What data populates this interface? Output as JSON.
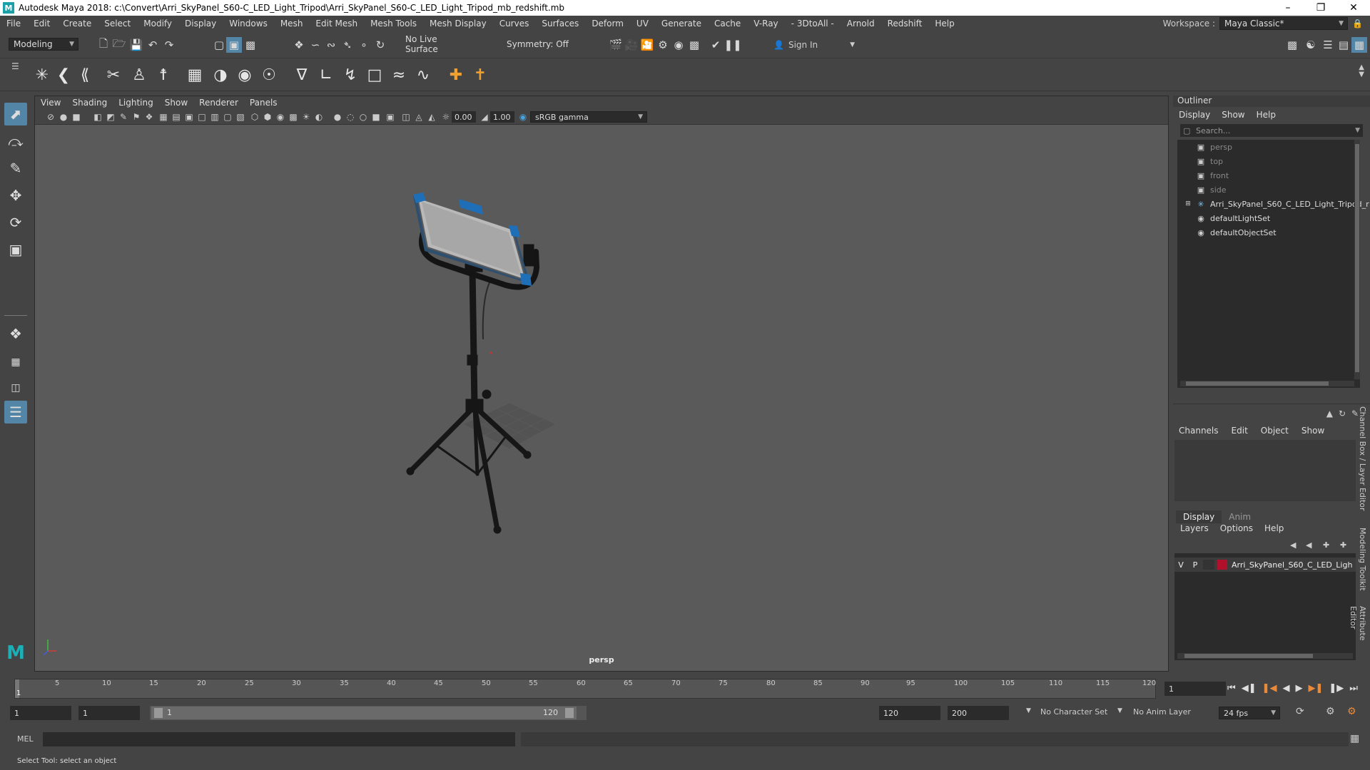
{
  "title": "Autodesk Maya 2018: c:\\Convert\\Arri_SkyPanel_S60-C_LED_Light_Tripod\\Arri_SkyPanel_S60-C_LED_Light_Tripod_mb_redshift.mb",
  "menubar": [
    "File",
    "Edit",
    "Create",
    "Select",
    "Modify",
    "Display",
    "Windows",
    "Mesh",
    "Edit Mesh",
    "Mesh Tools",
    "Mesh Display",
    "Curves",
    "Surfaces",
    "Deform",
    "UV",
    "Generate",
    "Cache",
    "V-Ray",
    "- 3DtoAll -",
    "Arnold",
    "Redshift",
    "Help"
  ],
  "workspace": {
    "label": "Workspace :",
    "value": "Maya Classic*"
  },
  "status": {
    "mode": "Modeling",
    "live_surface": "No Live Surface",
    "symmetry": "Symmetry: Off",
    "sign_in": "Sign In"
  },
  "viewport": {
    "menu": [
      "View",
      "Shading",
      "Lighting",
      "Show",
      "Renderer",
      "Panels"
    ],
    "exposure": "0.00",
    "gamma": "1.00",
    "colorspace": "sRGB gamma",
    "camera_label": "persp"
  },
  "outliner": {
    "title": "Outliner",
    "menu": [
      "Display",
      "Show",
      "Help"
    ],
    "search_placeholder": "Search...",
    "items": [
      "persp",
      "top",
      "front",
      "side",
      "Arri_SkyPanel_S60_C_LED_Light_Tripod_r",
      "defaultLightSet",
      "defaultObjectSet"
    ]
  },
  "channelbox": {
    "menu": [
      "Channels",
      "Edit",
      "Object",
      "Show"
    ]
  },
  "layereditor": {
    "tabs": [
      "Display",
      "Anim"
    ],
    "menu": [
      "Layers",
      "Options",
      "Help"
    ],
    "layer": {
      "v": "V",
      "p": "P",
      "name": "Arri_SkyPanel_S60_C_LED_Ligh",
      "color": "#b0102a"
    }
  },
  "sidetabs": [
    "Channel Box / Layer Editor",
    "Modeling Toolkit",
    "Attribute Editor"
  ],
  "timeslider": {
    "ticks": [
      "5",
      "10",
      "15",
      "20",
      "25",
      "30",
      "35",
      "40",
      "45",
      "50",
      "55",
      "60",
      "65",
      "70",
      "75",
      "80",
      "85",
      "90",
      "95",
      "100",
      "105",
      "110",
      "115",
      "120"
    ],
    "current_marker": "1",
    "current_frame": "1"
  },
  "range": {
    "start": "1",
    "playback_start": "1",
    "slider_start": "1",
    "slider_end": "120",
    "end": "120",
    "anim_end": "200",
    "character_set": "No Character Set",
    "anim_layer": "No Anim Layer",
    "fps": "24 fps"
  },
  "cmdline": {
    "label": "MEL"
  },
  "helpline": "Select Tool: select an object"
}
